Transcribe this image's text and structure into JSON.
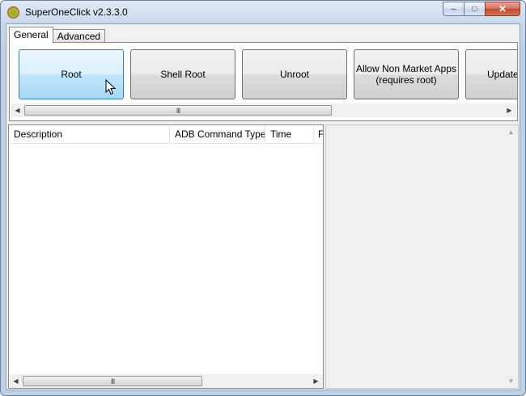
{
  "window": {
    "title": "SuperOneClick v2.3.3.0",
    "icon": "android-app-icon",
    "caption": {
      "minimize": "–",
      "maximize": "□",
      "close": "✕"
    }
  },
  "tabs": [
    {
      "label": "General",
      "active": true
    },
    {
      "label": "Advanced",
      "active": false
    }
  ],
  "actions": {
    "root": "Root",
    "shell_root": "Shell Root",
    "unroot": "Unroot",
    "allow_non_market_line1": "Allow Non Market Apps",
    "allow_non_market_line2": "(requires root)",
    "update": "Update"
  },
  "scrollbar": {
    "left_arrow": "◀",
    "right_arrow": "▶",
    "up_arrow": "▲",
    "down_arrow": "▼",
    "grip": "III"
  },
  "log_table": {
    "columns": [
      "Description",
      "ADB Command Type",
      "Time",
      "F"
    ],
    "rows": []
  },
  "colors": {
    "hover_accent": "#3c7fb1",
    "close_red": "#c5452b"
  }
}
